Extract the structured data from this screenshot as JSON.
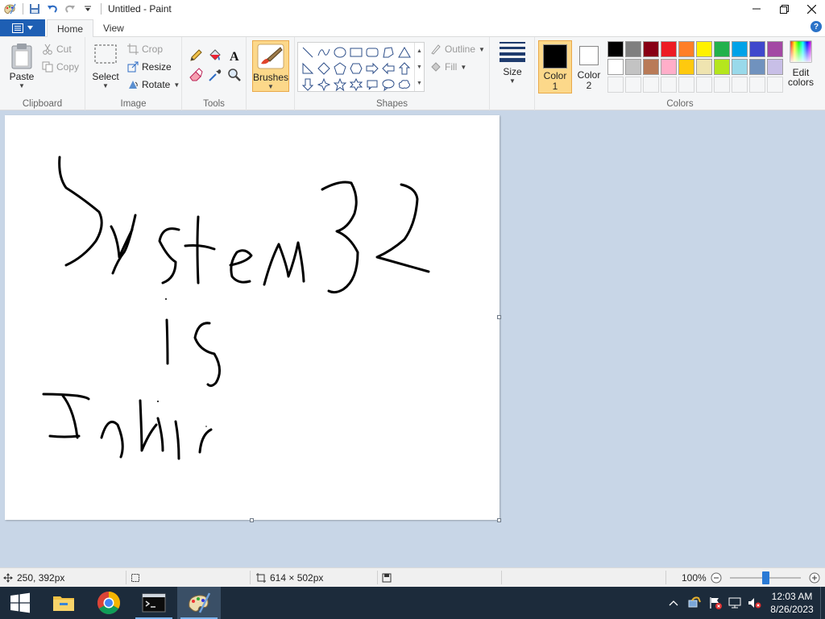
{
  "window": {
    "title": "Untitled - Paint"
  },
  "tabs": {
    "file_icon": "menu-icon",
    "home": "Home",
    "view": "View"
  },
  "ribbon": {
    "clipboard": {
      "label": "Clipboard",
      "paste": "Paste",
      "cut": "Cut",
      "copy": "Copy"
    },
    "image": {
      "label": "Image",
      "select": "Select",
      "crop": "Crop",
      "resize": "Resize",
      "rotate": "Rotate"
    },
    "tools": {
      "label": "Tools"
    },
    "brushes": {
      "label": "Brushes"
    },
    "shapes": {
      "label": "Shapes",
      "outline": "Outline",
      "fill": "Fill"
    },
    "size": {
      "label": "Size"
    },
    "colors": {
      "label": "Colors",
      "color1_line1": "Color",
      "color1_line2": "1",
      "color2_line1": "Color",
      "color2_line2": "2",
      "edit_line1": "Edit",
      "edit_line2": "colors",
      "color1_value": "#000000",
      "color2_value": "#ffffff",
      "palette": [
        "#000000",
        "#7f7f7f",
        "#880015",
        "#ed1c24",
        "#ff7f27",
        "#fff200",
        "#22b14c",
        "#00a2e8",
        "#3f48cc",
        "#a349a4",
        "#ffffff",
        "#c3c3c3",
        "#b97a57",
        "#ffaec9",
        "#ffc90e",
        "#efe4b0",
        "#b5e61d",
        "#99d9ea",
        "#7092be",
        "#c8bfe7"
      ]
    }
  },
  "status": {
    "cursor_pos": "250, 392px",
    "canvas_size": "614 × 502px",
    "zoom": "100%"
  },
  "taskbar": {
    "time": "12:03 AM",
    "date": "8/26/2023",
    "apps": [
      "start-icon",
      "file-explorer-icon",
      "chrome-icon",
      "command-prompt-icon",
      "paint-icon"
    ]
  }
}
